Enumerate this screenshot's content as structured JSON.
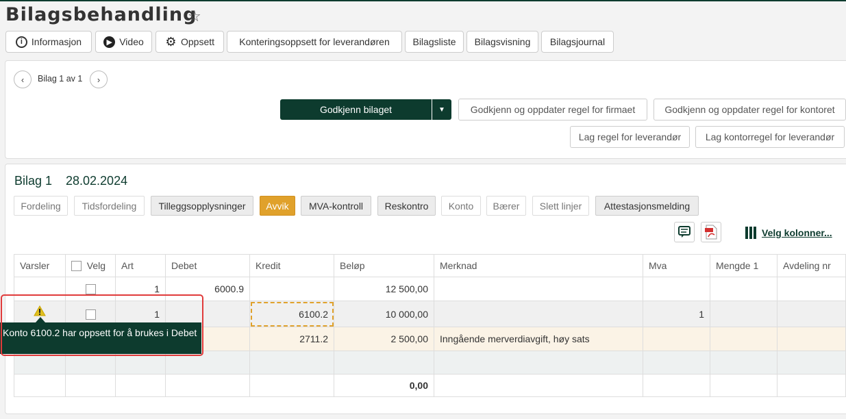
{
  "page": {
    "title": "Bilagsbehandling"
  },
  "toolbar": {
    "informasjon": "Informasjon",
    "video": "Video",
    "oppsett": "Oppsett",
    "konteringsoppsett": "Konteringsoppsett for leverandøren",
    "bilagsliste": "Bilagsliste",
    "bilagsvisning": "Bilagsvisning",
    "bilagsjournal": "Bilagsjournal"
  },
  "nav": {
    "text": "Bilag 1 av 1"
  },
  "actions": {
    "godkjenn": "Godkjenn bilaget",
    "godkjenn_firma": "Godkjenn og oppdater regel for firmaet",
    "godkjenn_kontor": "Godkjenn og oppdater regel for kontoret",
    "lag_leverandor": "Lag regel for leverandør",
    "lag_kontor": "Lag kontorregel for leverandør"
  },
  "bilag": {
    "label": "Bilag 1",
    "date": "28.02.2024"
  },
  "tabs": {
    "fordeling": "Fordeling",
    "tidsfordeling": "Tidsfordeling",
    "tillegg": "Tilleggsopplysninger",
    "avvik": "Avvik",
    "mva": "MVA-kontroll",
    "reskontro": "Reskontro",
    "konto": "Konto",
    "baerer": "Bærer",
    "slett": "Slett linjer",
    "attest": "Attestasjonsmelding"
  },
  "velg_kolonner": "Velg kolonner...",
  "columns": {
    "varsler": "Varsler",
    "velg": "Velg",
    "art": "Art",
    "debet": "Debet",
    "kredit": "Kredit",
    "belop": "Beløp",
    "merknad": "Merknad",
    "mva": "Mva",
    "mengde": "Mengde 1",
    "avdeling": "Avdeling nr"
  },
  "rows": [
    {
      "art": "1",
      "debet": "6000.9",
      "kredit": "",
      "belop": "12 500,00",
      "merknad": "",
      "mva": ""
    },
    {
      "art": "1",
      "debet": "",
      "kredit": "6100.2",
      "belop": "10 000,00",
      "merknad": "",
      "mva": "1"
    },
    {
      "art": "",
      "debet": "",
      "kredit": "2711.2",
      "belop": "2 500,00",
      "merknad": "Inngående merverdiavgift, høy sats",
      "mva": ""
    }
  ],
  "total": "0,00",
  "tooltip": {
    "text": "Konto 6100.2 har oppsett for å brukes i Debet"
  },
  "colors": {
    "primary": "#0d3b2e",
    "warning": "#e0a12b",
    "alert_border": "#e03a3a"
  }
}
